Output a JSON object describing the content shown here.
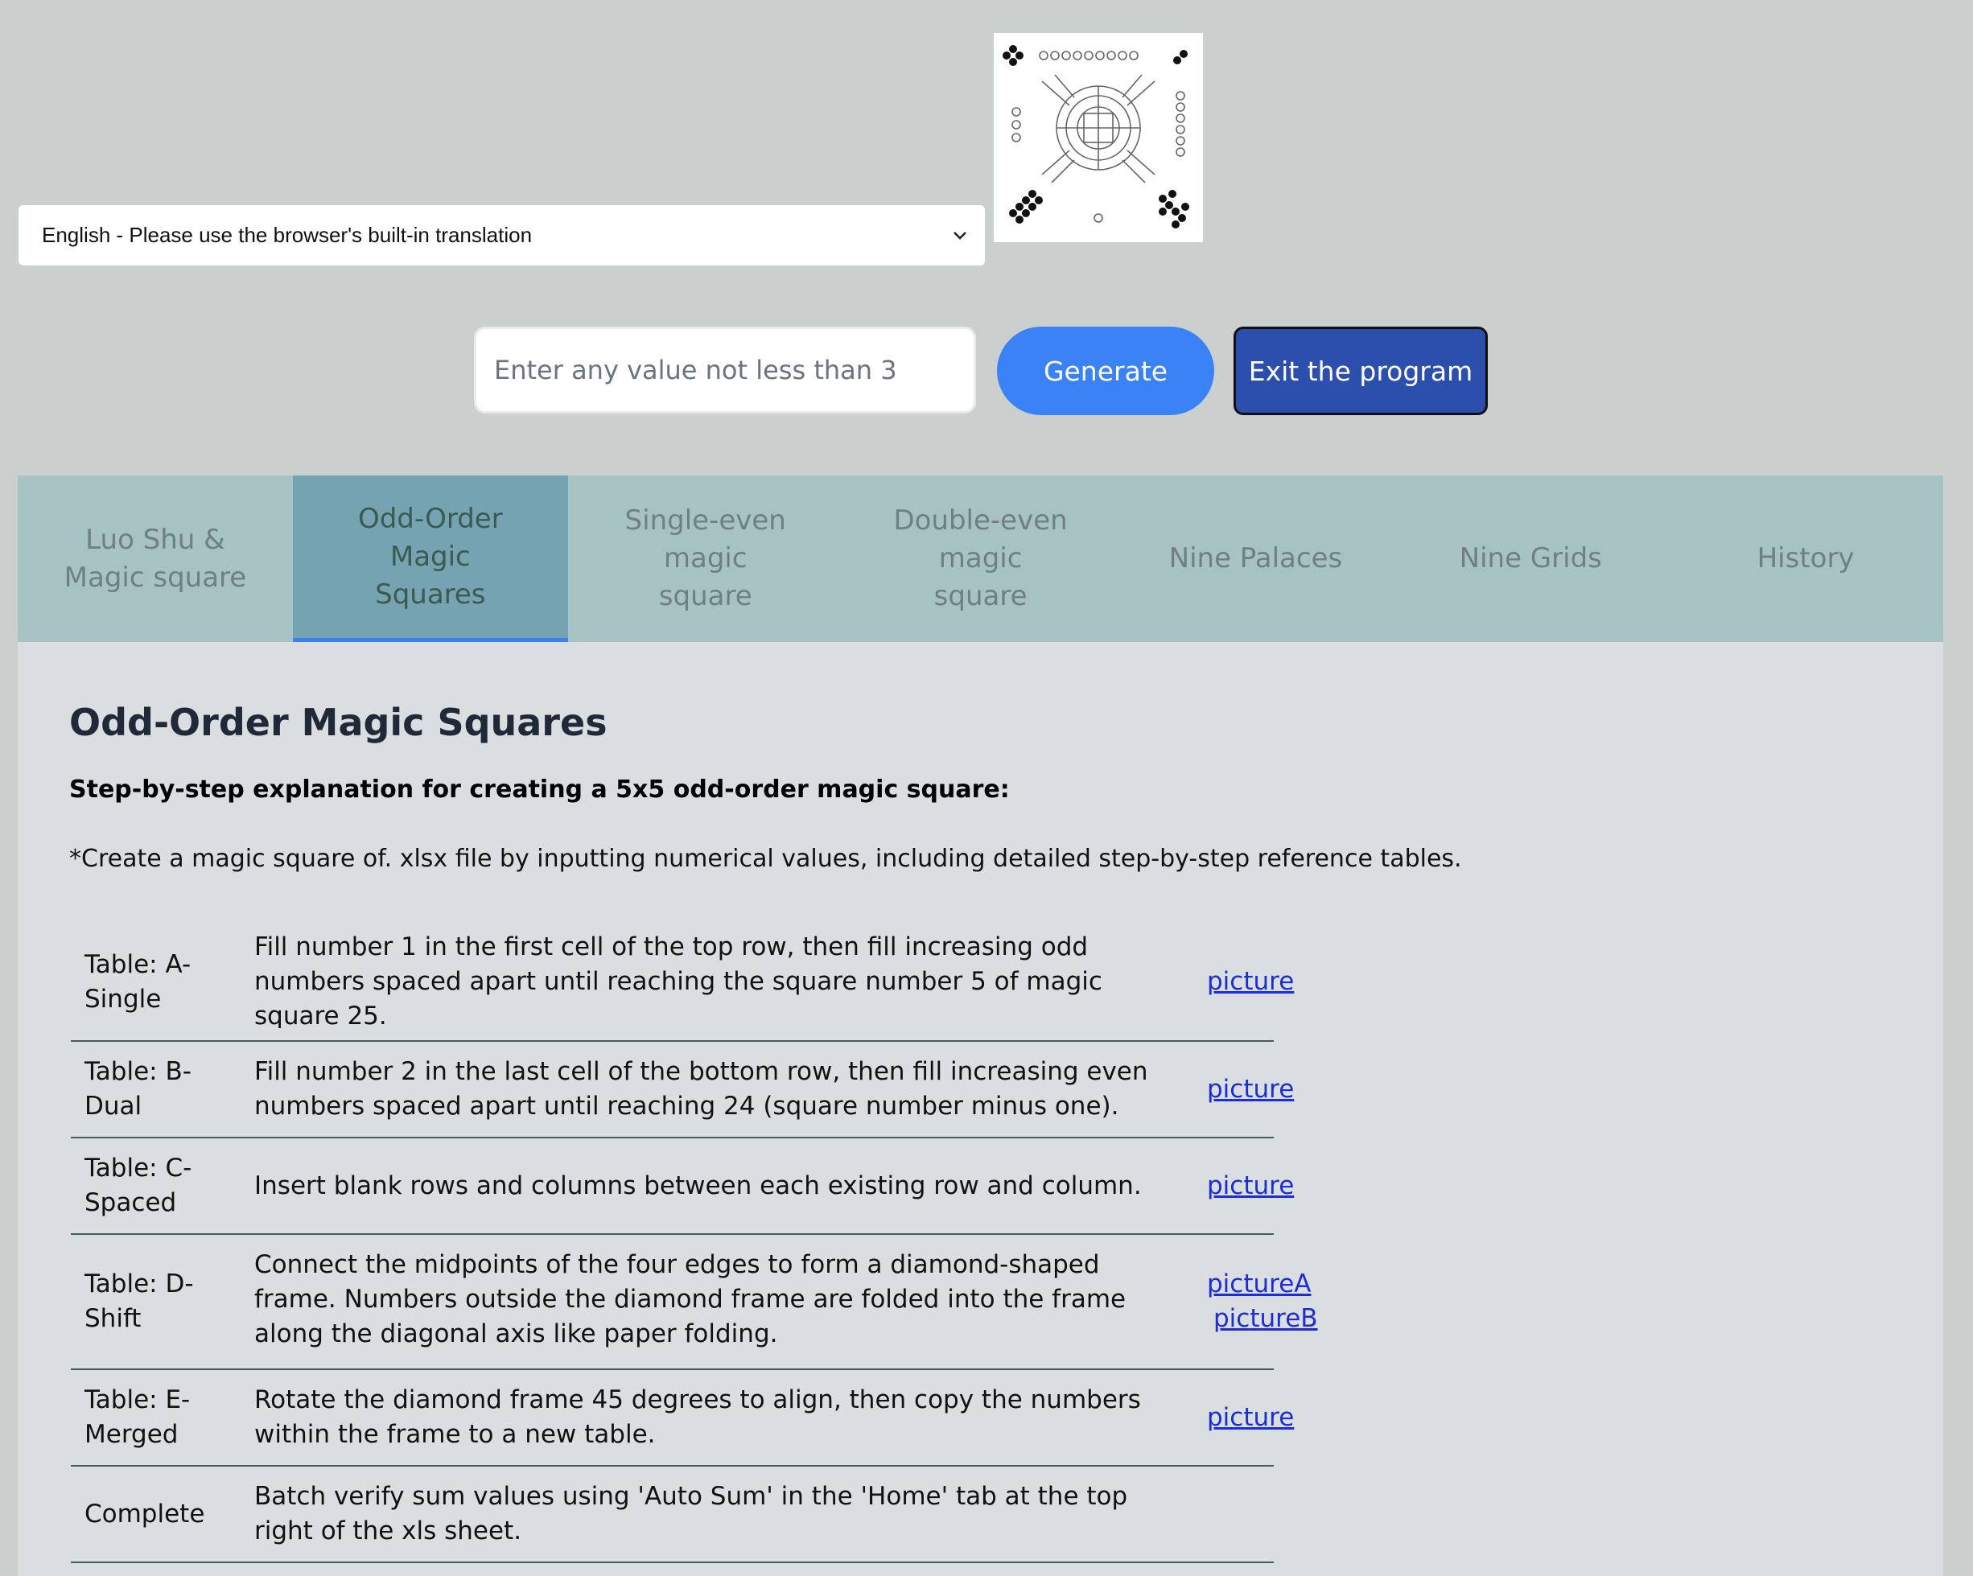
{
  "language_select": {
    "value": "English - Please use the browser's built-in translation"
  },
  "logo": {
    "icon": "luo-shu-diagram-icon"
  },
  "input": {
    "placeholder": "Enter any value not less than 3",
    "value": ""
  },
  "buttons": {
    "generate": "Generate",
    "exit": "Exit the program"
  },
  "tabs": [
    {
      "label": "Luo Shu & Magic square",
      "active": false
    },
    {
      "label": "Odd-Order Magic Squares",
      "active": true
    },
    {
      "label": "Single-even magic square",
      "active": false
    },
    {
      "label": "Double-even magic square",
      "active": false
    },
    {
      "label": "Nine Palaces",
      "active": false
    },
    {
      "label": "Nine Grids",
      "active": false
    },
    {
      "label": "History",
      "active": false
    }
  ],
  "panel": {
    "title": "Odd-Order Magic Squares",
    "subtitle": "Step-by-step explanation for creating a 5x5 odd-order magic square:",
    "note": "*Create a magic square of. xlsx file by inputting numerical values, including detailed step-by-step reference tables."
  },
  "steps": [
    {
      "label": "Table: A-Single",
      "description": "Fill number 1 in the first cell of the top row, then fill increasing odd numbers spaced apart until reaching the square number 5 of magic square 25.",
      "links": [
        "picture"
      ]
    },
    {
      "label": "Table: B-Dual",
      "description": "Fill number 2 in the last cell of the bottom row, then fill increasing even numbers spaced apart until reaching 24 (square number minus one).",
      "links": [
        "picture"
      ]
    },
    {
      "label": "Table: C-Spaced",
      "description": "Insert blank rows and columns between each existing row and column.",
      "links": [
        "picture"
      ]
    },
    {
      "label": "Table: D-Shift",
      "description": "Connect the midpoints of the four edges to form a diamond-shaped frame. Numbers outside the diamond frame are folded into the frame along the diagonal axis like paper folding.",
      "links": [
        "pictureA",
        "pictureB"
      ]
    },
    {
      "label": "Table: E-Merged",
      "description": "Rotate the diamond frame 45 degrees to align, then copy the numbers within the frame to a new table.",
      "links": [
        "picture"
      ]
    },
    {
      "label": "Complete",
      "description": "Batch verify sum values using 'Auto Sum' in the 'Home' tab at the top right of the xls sheet.",
      "links": []
    }
  ]
}
